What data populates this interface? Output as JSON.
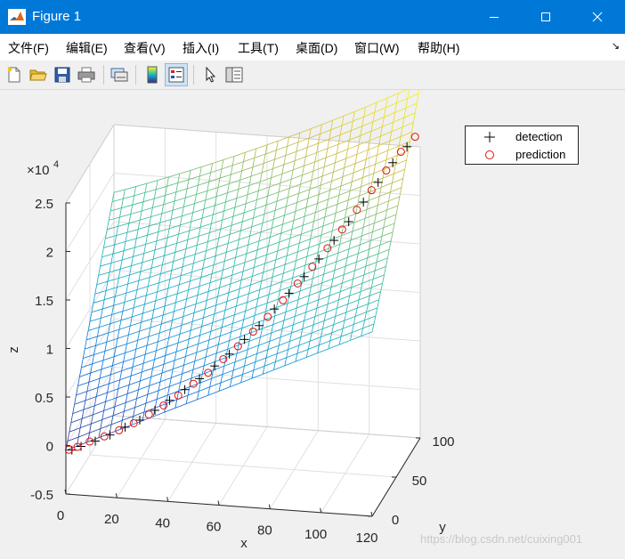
{
  "window": {
    "title": "Figure 1",
    "minimize_icon": "minimize-icon",
    "maximize_icon": "maximize-icon",
    "close_icon": "close-icon"
  },
  "menu": {
    "items": [
      "文件(F)",
      "编辑(E)",
      "查看(V)",
      "插入(I)",
      "工具(T)",
      "桌面(D)",
      "窗口(W)",
      "帮助(H)"
    ],
    "corner_glyph": "↘"
  },
  "toolbar": {
    "icons": [
      "new-figure-icon",
      "open-file-icon",
      "save-icon",
      "print-icon",
      "link-plot-icon",
      "colorbar-icon",
      "legend-icon",
      "pointer-icon",
      "property-inspector-icon"
    ],
    "active": "legend-icon"
  },
  "chart_data": {
    "type": "surface3d",
    "xlabel": "x",
    "ylabel": "y",
    "zlabel": "z",
    "z_exponent_label": "×10",
    "z_exponent_power": "4",
    "xlim": [
      0,
      120
    ],
    "ylim": [
      0,
      100
    ],
    "zlim": [
      -5000,
      25000
    ],
    "x_ticks": [
      "0",
      "20",
      "40",
      "60",
      "80",
      "100",
      "120"
    ],
    "y_ticks": [
      "0",
      "50",
      "100"
    ],
    "z_ticks": [
      "-0.5",
      "0",
      "0.5",
      "1",
      "1.5",
      "2",
      "2.5"
    ],
    "grid": true,
    "legend": {
      "position": "top-right",
      "entries": [
        {
          "label": "detection",
          "marker": "plus",
          "color": "#000000"
        },
        {
          "label": "prediction",
          "marker": "circle",
          "color": "#e01010"
        }
      ]
    },
    "surface": {
      "colormap": "parula",
      "corner_values": {
        "x0_y0": -500,
        "x0_y100": 18000,
        "x120_y0": 14000,
        "x120_y100": 26000
      }
    },
    "series": [
      {
        "name": "detection",
        "points": [
          [
            2,
            2,
            -600
          ],
          [
            5,
            5,
            -400
          ],
          [
            10,
            8,
            0
          ],
          [
            15,
            12,
            400
          ],
          [
            20,
            17,
            900
          ],
          [
            25,
            21,
            1400
          ],
          [
            30,
            26,
            2100
          ],
          [
            35,
            30,
            2900
          ],
          [
            40,
            35,
            3700
          ],
          [
            45,
            39,
            4600
          ],
          [
            50,
            44,
            5600
          ],
          [
            55,
            48,
            6600
          ],
          [
            60,
            53,
            7800
          ],
          [
            65,
            57,
            9000
          ],
          [
            70,
            62,
            10400
          ],
          [
            75,
            66,
            11800
          ],
          [
            80,
            71,
            13200
          ],
          [
            85,
            75,
            14800
          ],
          [
            90,
            80,
            16400
          ],
          [
            95,
            84,
            18100
          ],
          [
            100,
            88,
            19900
          ],
          [
            105,
            92,
            21700
          ],
          [
            110,
            96,
            23500
          ],
          [
            115,
            99,
            25000
          ]
        ]
      },
      {
        "name": "prediction",
        "points": [
          [
            1,
            1,
            -500
          ],
          [
            4,
            3,
            -300
          ],
          [
            8,
            7,
            0
          ],
          [
            13,
            11,
            300
          ],
          [
            18,
            15,
            700
          ],
          [
            23,
            19,
            1200
          ],
          [
            28,
            24,
            1800
          ],
          [
            33,
            28,
            2500
          ],
          [
            38,
            32,
            3300
          ],
          [
            43,
            37,
            4200
          ],
          [
            48,
            41,
            5100
          ],
          [
            53,
            46,
            6200
          ],
          [
            58,
            50,
            7300
          ],
          [
            63,
            55,
            8500
          ],
          [
            68,
            59,
            9800
          ],
          [
            73,
            64,
            11200
          ],
          [
            78,
            68,
            12700
          ],
          [
            83,
            72,
            14200
          ],
          [
            88,
            77,
            15800
          ],
          [
            93,
            81,
            17500
          ],
          [
            98,
            85,
            19300
          ],
          [
            103,
            89,
            21100
          ],
          [
            108,
            93,
            22900
          ],
          [
            113,
            97,
            24600
          ],
          [
            118,
            100,
            26000
          ]
        ]
      }
    ]
  },
  "watermark": "https://blog.csdn.net/cuixing001"
}
